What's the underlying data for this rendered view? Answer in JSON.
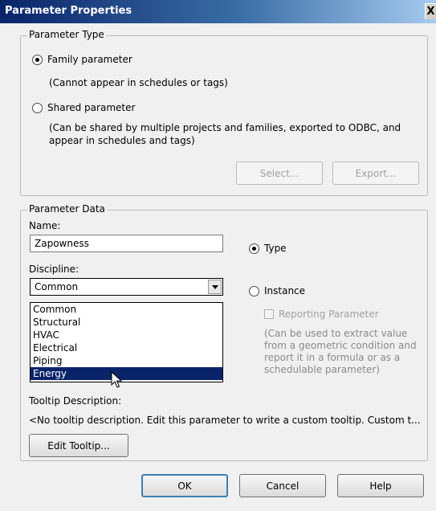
{
  "window": {
    "title": "Parameter Properties",
    "close_glyph": "X"
  },
  "parameter_type": {
    "legend": "Parameter Type",
    "family_label": "Family parameter",
    "family_note": "(Cannot appear in schedules or tags)",
    "shared_label": "Shared parameter",
    "shared_note_line1": "(Can be shared by multiple projects and families, exported to ODBC, and",
    "shared_note_line2": "appear in schedules and tags)",
    "select_button": "Select...",
    "export_button": "Export..."
  },
  "parameter_data": {
    "legend": "Parameter Data",
    "name_label": "Name:",
    "name_value": "Zapowness",
    "discipline_label": "Discipline:",
    "discipline_value": "Common",
    "discipline_options": [
      "Common",
      "Structural",
      "HVAC",
      "Electrical",
      "Piping",
      "Energy"
    ],
    "discipline_highlighted": "Energy",
    "type_label": "Type",
    "instance_label": "Instance",
    "reporting_label": "Reporting Parameter",
    "reporting_note": [
      "(Can be used to extract value",
      "from a geometric condition and",
      "report it in a formula or as a",
      "schedulable parameter)"
    ],
    "tooltip_label": "Tooltip Description:",
    "tooltip_text": "<No tooltip description. Edit this parameter to write a custom tooltip. Custom t...",
    "edit_tooltip_button": "Edit Tooltip..."
  },
  "footer": {
    "ok": "OK",
    "cancel": "Cancel",
    "help": "Help"
  }
}
